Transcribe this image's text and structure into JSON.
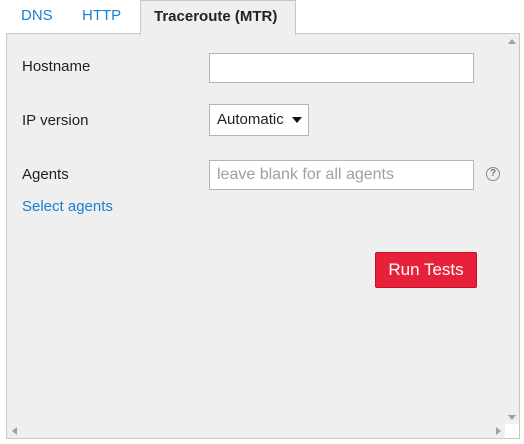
{
  "tabs": [
    {
      "label": "DNS",
      "active": false
    },
    {
      "label": "HTTP",
      "active": false
    },
    {
      "label": "Traceroute (MTR)",
      "active": true
    }
  ],
  "form": {
    "hostname": {
      "label": "Hostname",
      "value": "",
      "placeholder": ""
    },
    "ip_version": {
      "label": "IP version",
      "selected": "Automatic"
    },
    "agents": {
      "label": "Agents",
      "value": "",
      "placeholder": "leave blank for all agents",
      "help_symbol": "?"
    },
    "select_agents_link": "Select agents",
    "run_button": "Run Tests"
  },
  "colors": {
    "link": "#1a7fd0",
    "run_button": "#e8213a",
    "panel_background": "#efefef"
  },
  "icons": {
    "select_caret": "chevron-down-icon",
    "help": "help-icon"
  }
}
